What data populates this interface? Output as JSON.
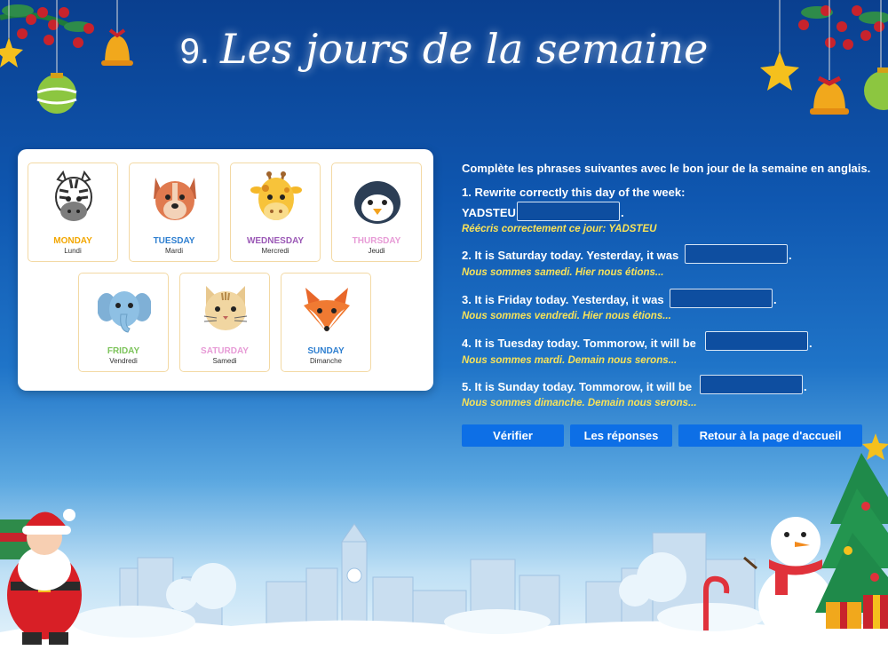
{
  "title": {
    "number": "9.",
    "text": "Les jours de la semaine"
  },
  "days": [
    {
      "en": "MONDAY",
      "fr": "Lundi",
      "color": "#f2a600",
      "animal": "zebra-icon"
    },
    {
      "en": "TUESDAY",
      "fr": "Mardi",
      "color": "#2e7fd0",
      "animal": "dog-icon"
    },
    {
      "en": "WEDNESDAY",
      "fr": "Mercredi",
      "color": "#9b59b6",
      "animal": "giraffe-icon"
    },
    {
      "en": "THURSDAY",
      "fr": "Jeudi",
      "color": "#e79bd6",
      "animal": "penguin-icon"
    },
    {
      "en": "FRIDAY",
      "fr": "Vendredi",
      "color": "#7cc35a",
      "animal": "elephant-icon"
    },
    {
      "en": "SATURDAY",
      "fr": "Samedi",
      "color": "#e79bd6",
      "animal": "cat-icon"
    },
    {
      "en": "SUNDAY",
      "fr": "Dimanche",
      "color": "#2e7fd0",
      "animal": "fox-icon"
    }
  ],
  "exercise": {
    "instruction": "Complète les phrases suivantes avec le bon jour de la semaine en anglais.",
    "q1": {
      "prompt": "1. Rewrite correctly this day of the week:",
      "word": "YADSTEU",
      "hint": "Réécris correctement ce jour: YADSTEU",
      "value": ""
    },
    "q2": {
      "prompt": "2. It is Saturday today. Yesterday, it was",
      "hint": "Nous sommes samedi. Hier nous étions...",
      "value": ""
    },
    "q3": {
      "prompt": "3. It is Friday today. Yesterday, it was",
      "hint": "Nous sommes vendredi. Hier nous étions...",
      "value": ""
    },
    "q4": {
      "prompt": "4. It is Tuesday today. Tommorow, it will be",
      "hint": "Nous sommes mardi. Demain nous serons...",
      "value": ""
    },
    "q5": {
      "prompt": "5. It is Sunday today. Tommorow, it will be",
      "hint": "Nous sommes dimanche. Demain nous serons...",
      "value": ""
    },
    "end_dot": "."
  },
  "buttons": {
    "verify": "Vérifier",
    "answers": "Les réponses",
    "home": "Retour à la page d'accueil"
  },
  "colors": {
    "button": "#0d6fe6",
    "hint": "#f7e25a",
    "tile_border": "#f3d9a4"
  }
}
